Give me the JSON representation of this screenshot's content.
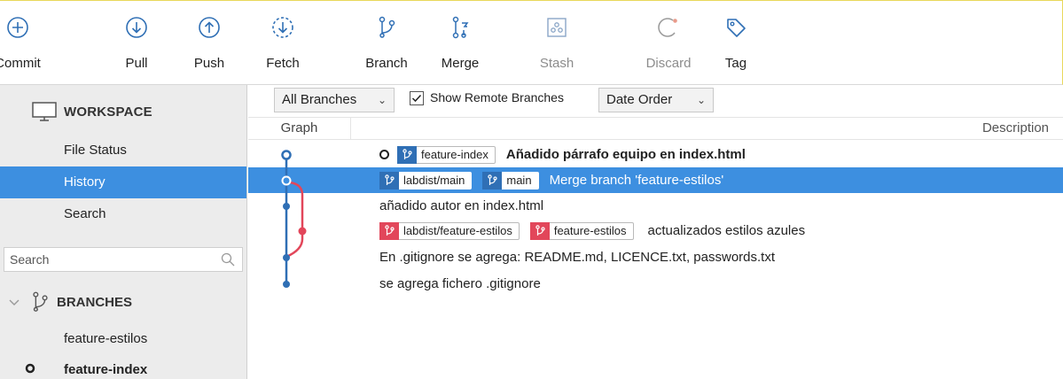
{
  "toolbar": {
    "commit": "Commit",
    "pull": "Pull",
    "push": "Push",
    "fetch": "Fetch",
    "branch": "Branch",
    "merge": "Merge",
    "stash": "Stash",
    "discard": "Discard",
    "tag": "Tag"
  },
  "sidebar": {
    "workspace": "WORKSPACE",
    "items": [
      {
        "label": "File Status"
      },
      {
        "label": "History"
      },
      {
        "label": "Search"
      }
    ],
    "search_placeholder": "Search",
    "branches_header": "BRANCHES",
    "branches": [
      {
        "label": "feature-estilos"
      },
      {
        "label": "feature-index"
      }
    ]
  },
  "filter": {
    "branches": "All Branches",
    "show_remote": "Show Remote Branches",
    "order": "Date Order"
  },
  "columns": {
    "graph": "Graph",
    "description": "Description"
  },
  "commits": [
    {
      "tags": [
        {
          "label": "feature-index"
        }
      ],
      "message": "Añadido párrafo equipo en index.html"
    },
    {
      "tags": [
        {
          "label": "labdist/main"
        },
        {
          "label": "main"
        }
      ],
      "message": "Merge branch 'feature-estilos'"
    },
    {
      "tags": [],
      "message": "añadido autor en index.html"
    },
    {
      "tags": [
        {
          "label": "labdist/feature-estilos"
        },
        {
          "label": "feature-estilos"
        }
      ],
      "message": "actualizados estilos azules"
    },
    {
      "tags": [],
      "message": "En .gitignore se agrega: README.md, LICENCE.txt, passwords.txt"
    },
    {
      "tags": [],
      "message": "se agrega fichero .gitignore"
    }
  ],
  "colors": {
    "accent": "#3d8fe0",
    "graph_blue": "#2f6fb5",
    "graph_red": "#e2465a"
  }
}
